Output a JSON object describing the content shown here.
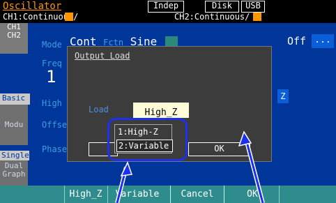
{
  "topbar": {
    "title": "Oscillator",
    "indep": "Indep",
    "disk": "Disk",
    "usb": "USB",
    "ch1_status": "CH1:Continuous/",
    "ch2_status": "CH2:Continuous/"
  },
  "sidebar": {
    "ch1": "CH1",
    "ch2": "CH2",
    "basic": "Basic",
    "modu": "Modu",
    "single": "Single",
    "dual": "Dual",
    "graph": "Graph"
  },
  "background": {
    "mode_label": "Mode",
    "mode_value": "Cont",
    "fctn_label": "Fctn",
    "fctn_value": "Sine",
    "freq_label": "Freq",
    "freq_value": "1",
    "high_label": "High",
    "offset_label": "Offse",
    "phase_label": "Phase",
    "off_label": "Off",
    "more_label": "...",
    "z_label": "Z"
  },
  "dialog": {
    "title": "Output Load",
    "load_label": "Load",
    "load_value": "High_Z",
    "ok_label": "OK",
    "options": [
      "1:High-Z",
      "2:Variable"
    ]
  },
  "softkeys": [
    "High_Z",
    "Variable",
    "Cancel",
    "OK"
  ],
  "colors": {
    "screen_blue": "#003599",
    "accent_orange": "#ff9600",
    "softkey_teal": "#2f8c8c",
    "dialog_gray": "#3c3c3c",
    "highlight_blue": "#1d2ff0"
  }
}
